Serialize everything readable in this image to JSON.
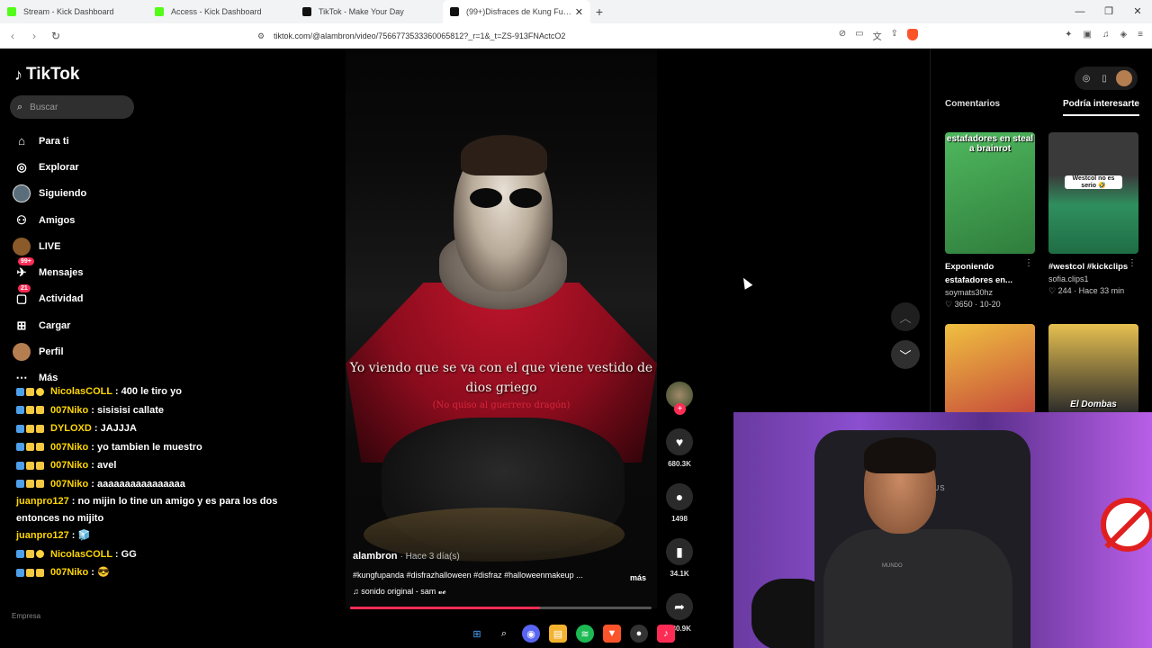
{
  "browser": {
    "tabs": [
      {
        "title": "Stream - Kick Dashboard",
        "icon": "kick-icon"
      },
      {
        "title": "Access - Kick Dashboard",
        "icon": "kick-icon"
      },
      {
        "title": "TikTok - Make Your Day",
        "icon": "tiktok-icon"
      },
      {
        "title": "(99+)Disfraces de Kung Fu Panda",
        "icon": "tiktok-icon"
      }
    ],
    "url": "tiktok.com/@alambron/video/7566773533360065812?_r=1&_t=ZS-913FNActcO2"
  },
  "tiktok": {
    "logo": "TikTok",
    "search_placeholder": "Buscar",
    "nav": [
      {
        "label": "Para ti",
        "icon": "home-icon"
      },
      {
        "label": "Explorar",
        "icon": "compass-icon"
      },
      {
        "label": "Siguiendo",
        "icon": "following-avatar-icon"
      },
      {
        "label": "Amigos",
        "icon": "friends-icon"
      },
      {
        "label": "LIVE",
        "icon": "live-icon"
      },
      {
        "label": "Mensajes",
        "icon": "messages-icon",
        "badge": "99+"
      },
      {
        "label": "Actividad",
        "icon": "activity-icon",
        "badge": "21"
      },
      {
        "label": "Cargar",
        "icon": "upload-icon"
      },
      {
        "label": "Perfil",
        "icon": "profile-icon"
      },
      {
        "label": "Más",
        "icon": "more-icon"
      }
    ],
    "footer": "Empresa"
  },
  "chat": [
    {
      "user": "NicolasCOLL",
      "sep": " : ",
      "msg": "400 le tiro yo"
    },
    {
      "user": "007Niko",
      "sep": " : ",
      "msg": "sisisisi callate"
    },
    {
      "user": "DYLOXD",
      "sep": " : ",
      "msg": "JAJJJA"
    },
    {
      "user": "007Niko",
      "sep": " : ",
      "msg": "yo tambien le muestro"
    },
    {
      "user": "007Niko",
      "sep": " : ",
      "msg": "avel"
    },
    {
      "user": "007Niko",
      "sep": " : ",
      "msg": "aaaaaaaaaaaaaaaa"
    },
    {
      "user": "juanpro127",
      "sep": " : ",
      "msg": "no mijin lo tine un amigo y es para los dos entonces no mijito"
    },
    {
      "user": "juanpro127",
      "sep": " : ",
      "msg": "🧊"
    },
    {
      "user": "NicolasCOLL",
      "sep": " : ",
      "msg": "GG"
    },
    {
      "user": "007Niko",
      "sep": " : ",
      "msg": "😎"
    }
  ],
  "video": {
    "caption_main": "Yo viendo que se va con el que viene vestido de dios griego",
    "caption_sub": "(No quiso al guerrero dragón)",
    "author": "alambron",
    "time": "· Hace 3 día(s)",
    "tags": "#kungfupanda #disfrazhalloween #disfraz #halloweenmakeup ...",
    "more": "más",
    "sound": "♫  sonido original - sam 𝓿𝓮",
    "progress_fraction": 0.63
  },
  "actions": {
    "likes": "680.3K",
    "comments": "1498",
    "saves": "34.1K",
    "shares": "380.9K"
  },
  "right_panel": {
    "tabs": [
      "Comentarios",
      "Podría interesarte"
    ],
    "suggestions": [
      {
        "thumb_text": "estafadores en steal a brainrot",
        "title": "Exponiendo estafadores en...",
        "author": "soymats30hz",
        "stats": "♡ 3650 · 10-20",
        "bg": "#3fa34d"
      },
      {
        "thumb_text": "Westcol no es serio 🤣",
        "title": "#westcol #kickclips",
        "author": "sofia.clips1",
        "stats": "♡ 244 · Hace 33 min",
        "bg": "#2e7d5a"
      },
      {
        "thumb_text": "",
        "title": "",
        "author": "",
        "stats": "",
        "bg": "#c64a3a"
      },
      {
        "thumb_text": "El Dombas",
        "title": "",
        "author": "",
        "stats": "",
        "bg": "#d8b040"
      }
    ]
  },
  "webcam": {
    "chair_brand": "ATIMUS",
    "shirt_brand": "MUNDO"
  },
  "colors": {
    "accent": "#fe2c55",
    "kick": "#53fc18"
  }
}
